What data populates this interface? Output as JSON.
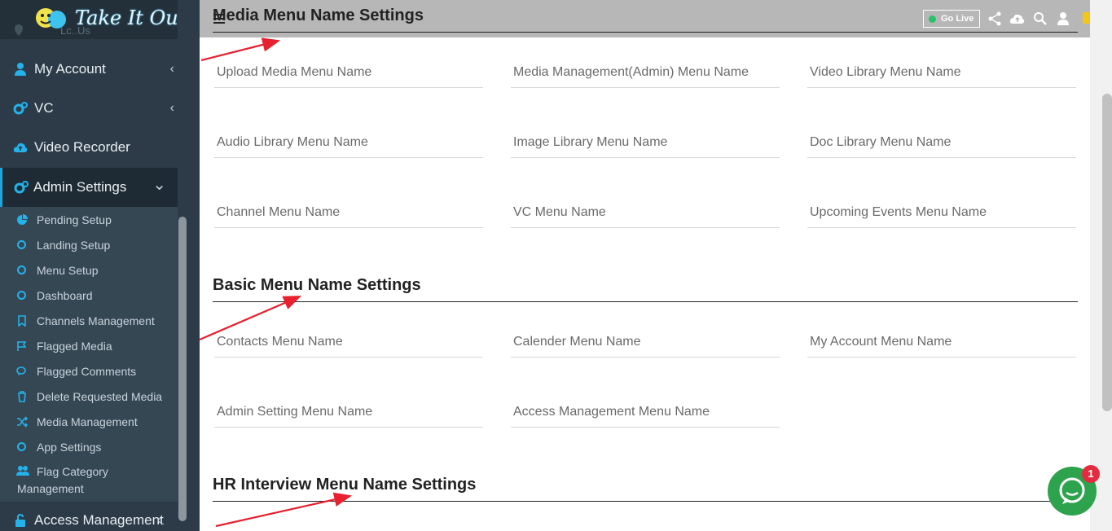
{
  "app": {
    "logo_text": "Take It Out",
    "behind_text": "Lc..Us"
  },
  "sidebar": {
    "items": [
      {
        "label": "My Account",
        "icon": "user-icon",
        "chevron": "‹"
      },
      {
        "label": "VC",
        "icon": "cogs-icon",
        "chevron": "‹"
      },
      {
        "label": "Video Recorder",
        "icon": "cloud-upload-icon"
      },
      {
        "label": "Admin Settings",
        "icon": "cogs-icon",
        "chevron": "⌄"
      },
      {
        "label": "Access Management",
        "icon": "lock-icon",
        "chevron": "‹"
      }
    ],
    "submenu": [
      {
        "label": "Pending Setup",
        "icon": "pie-chart-icon"
      },
      {
        "label": "Landing Setup",
        "icon": "circle-icon"
      },
      {
        "label": "Menu Setup",
        "icon": "circle-icon"
      },
      {
        "label": "Dashboard",
        "icon": "circle-icon"
      },
      {
        "label": "Channels Management",
        "icon": "bookmark-icon"
      },
      {
        "label": "Flagged Media",
        "icon": "flag-icon"
      },
      {
        "label": "Flagged Comments",
        "icon": "comments-icon"
      },
      {
        "label": "Delete Requested Media",
        "icon": "trash-icon"
      },
      {
        "label": "Media Management",
        "icon": "shuffle-icon"
      },
      {
        "label": "App Settings",
        "icon": "circle-icon"
      },
      {
        "label_line1": "Flag Category",
        "label_line2": "Management",
        "icon": "users-icon"
      }
    ]
  },
  "topbar": {
    "go_live": "Go Live"
  },
  "sections": {
    "media": {
      "title": "Media Menu Name Settings",
      "fields": [
        "Upload Media Menu Name",
        "Media Management(Admin) Menu Name",
        "Video Library Menu Name",
        "Audio Library Menu Name",
        "Image Library Menu Name",
        "Doc Library Menu Name",
        "Channel Menu Name",
        "VC Menu Name",
        "Upcoming Events Menu Name"
      ]
    },
    "basic": {
      "title": "Basic Menu Name Settings",
      "fields": [
        "Contacts Menu Name",
        "Calender Menu Name",
        "My Account Menu Name",
        "Admin Setting Menu Name",
        "Access Management Menu Name"
      ]
    },
    "hr": {
      "title": "HR Interview Menu Name Settings"
    }
  },
  "chat": {
    "badge_count": "1"
  },
  "colors": {
    "accent": "#1ea6dc",
    "arrow": "#e8202f",
    "chat": "#2ea34d"
  }
}
